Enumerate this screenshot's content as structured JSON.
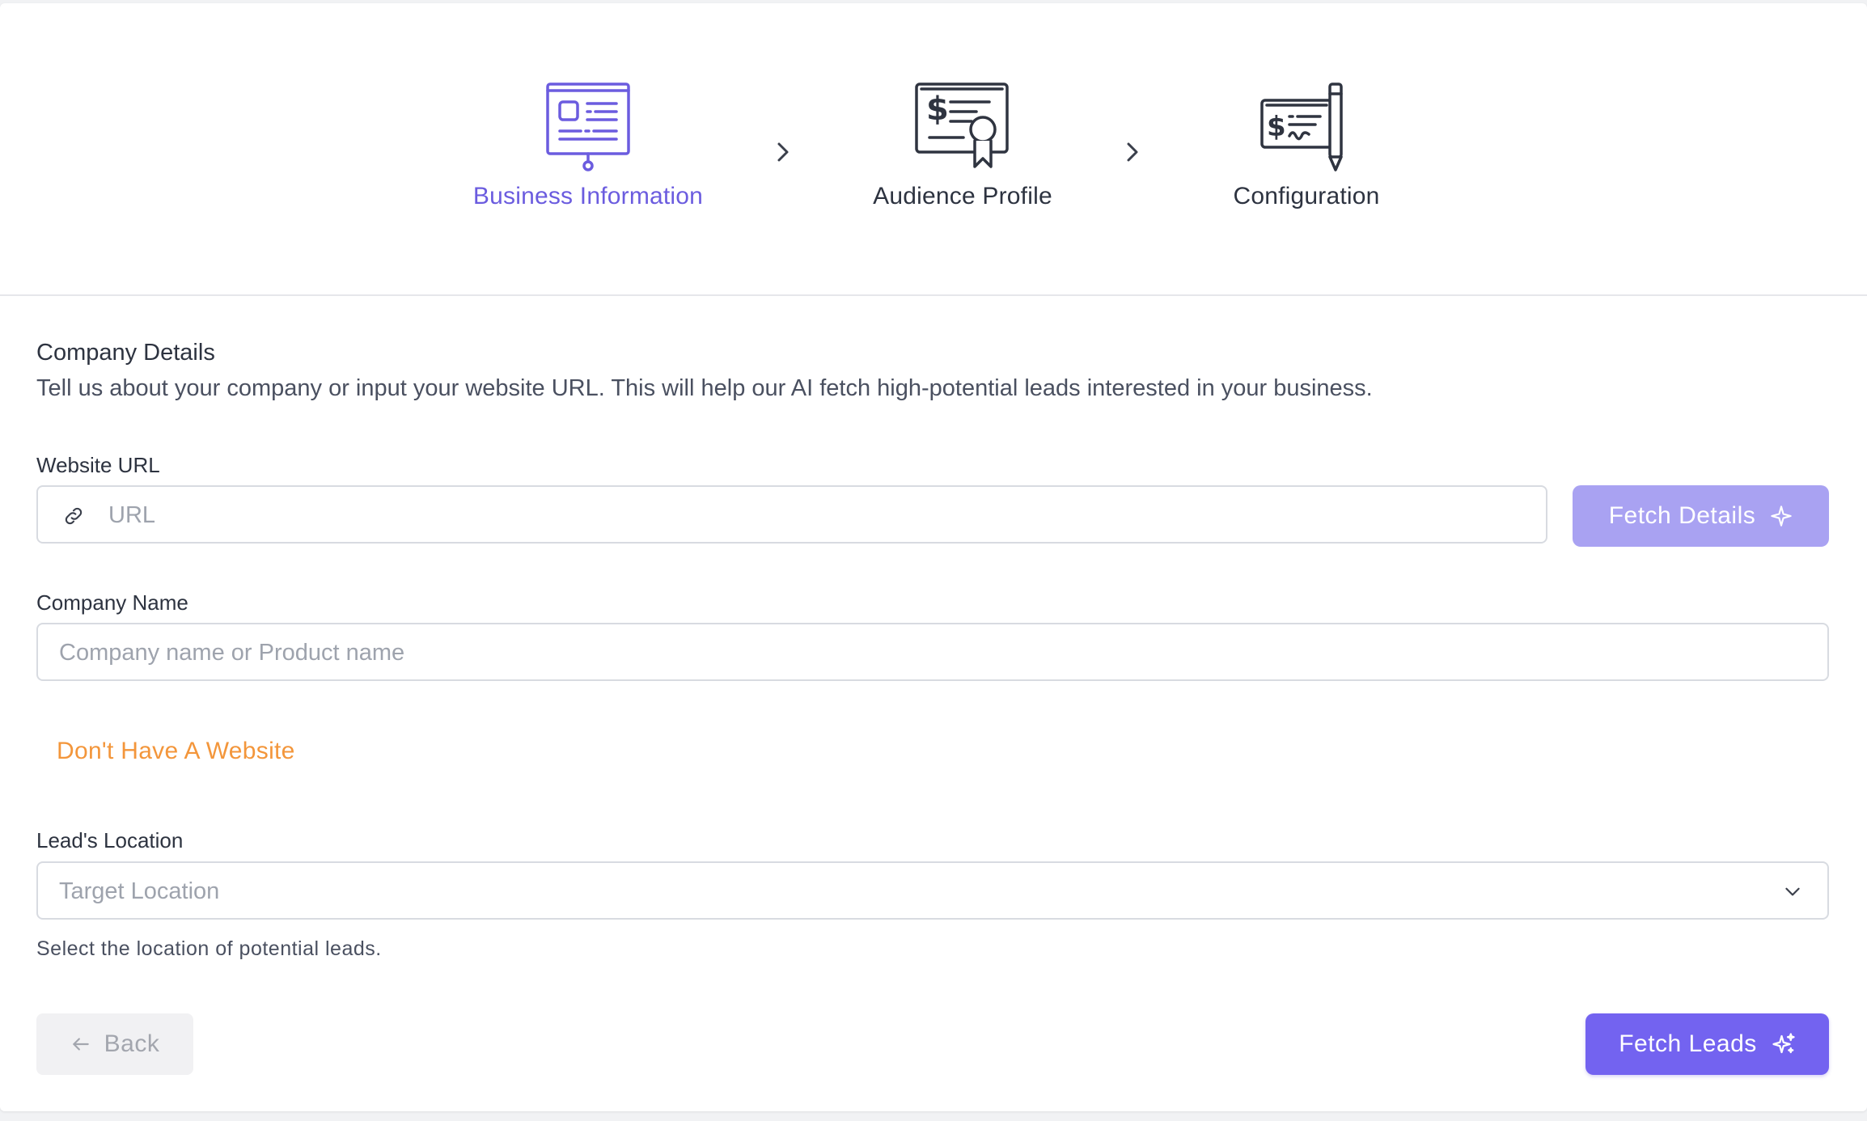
{
  "stepper": {
    "steps": [
      {
        "label": "Business Information",
        "icon": "presentation-board-icon",
        "active": true
      },
      {
        "label": "Audience Profile",
        "icon": "certificate-icon",
        "active": false
      },
      {
        "label": "Configuration",
        "icon": "check-pen-icon",
        "active": false
      }
    ]
  },
  "section": {
    "title": "Company Details",
    "description": "Tell us about your company or input your website URL. This will help our AI fetch high-potential leads interested in your business."
  },
  "website": {
    "label": "Website URL",
    "placeholder": "URL",
    "value": "",
    "icon": "link-icon",
    "fetch_button": "Fetch Details",
    "fetch_icon": "sparkle-icon"
  },
  "company": {
    "label": "Company Name",
    "placeholder": "Company name or Product name",
    "value": ""
  },
  "no_website_link": "Don't Have A Website",
  "location": {
    "label": "Lead's Location",
    "placeholder": "Target Location",
    "help": "Select the location of potential leads.",
    "icon": "chevron-down-icon"
  },
  "actions": {
    "back_label": "Back",
    "back_icon": "arrow-left-icon",
    "fetch_leads_label": "Fetch Leads",
    "fetch_leads_icon": "sparkles-icon"
  },
  "colors": {
    "accent": "#7363f0",
    "accent_disabled": "#a9a2f2",
    "active_step": "#6b5cdf",
    "link_orange": "#f3963b"
  }
}
